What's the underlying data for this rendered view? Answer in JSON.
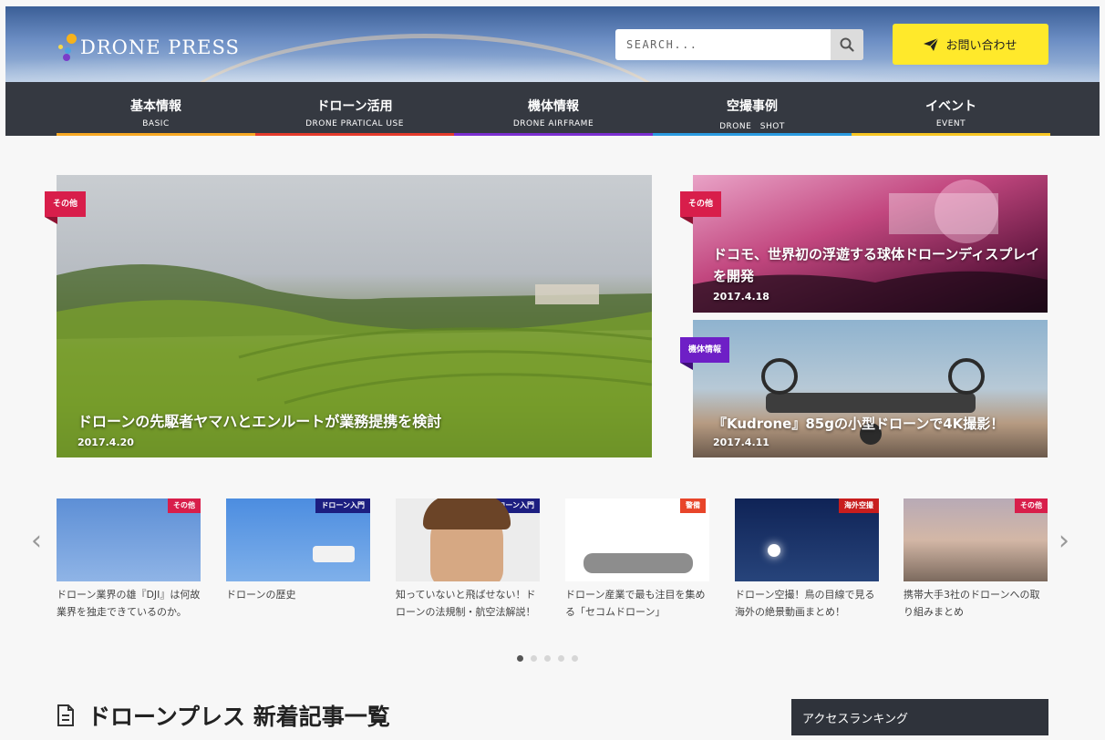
{
  "header": {
    "logo_text": "DRONE PRESS",
    "search_placeholder": "SEARCH...",
    "contact_label": "お問い合わせ"
  },
  "nav": [
    {
      "jp": "基本情報",
      "en": "BASIC",
      "color": "#f7a823"
    },
    {
      "jp": "ドローン活用",
      "en": "DRONE PRATICAL USE",
      "color": "#e53b2c"
    },
    {
      "jp": "機体情報",
      "en": "DRONE AIRFRAME",
      "color": "#7b2fd0"
    },
    {
      "jp": "空撮事例",
      "en": "DRONE　SHOT",
      "color": "#2b9be0"
    },
    {
      "jp": "イベント",
      "en": "EVENT",
      "color": "#f7c623"
    }
  ],
  "featured": {
    "main": {
      "tag": "その他",
      "title": "ドローンの先駆者ヤマハとエンルートが業務提携を検討",
      "date": "2017.4.20"
    },
    "side": [
      {
        "tag": "その他",
        "title": "ドコモ、世界初の浮遊する球体ドローンディスプレイを開発",
        "date": "2017.4.18"
      },
      {
        "tag": "機体情報",
        "title": "『Kudrone』85gの小型ドローンで4K撮影！",
        "date": "2017.4.11"
      }
    ]
  },
  "carousel": [
    {
      "tag": "その他",
      "tag_color": "#d81e4b",
      "title": "ドローン業界の雄『DJI』は何故業界を独走できているのか。"
    },
    {
      "tag": "ドローン入門",
      "tag_color": "#1c1e80",
      "title": "ドローンの歴史"
    },
    {
      "tag": "ドローン入門",
      "tag_color": "#1c1e80",
      "title": "知っていないと飛ばせない！ドローンの法規制・航空法解説！"
    },
    {
      "tag": "警備",
      "tag_color": "#e8452a",
      "title": "ドローン産業で最も注目を集める「セコムドローン」"
    },
    {
      "tag": "海外空撮",
      "tag_color": "#c81d1d",
      "title": "ドローン空撮！鳥の目線で見る海外の絶景動画まとめ！"
    },
    {
      "tag": "その他",
      "tag_color": "#d81e4b",
      "title": "携帯大手3社のドローンへの取り組みまとめ"
    }
  ],
  "section_title": "ドローンプレス 新着記事一覧",
  "ranking_title": "アクセスランキング",
  "icons": {
    "search": "magnifier-icon",
    "contact": "paper-plane-icon",
    "prev": "chevron-left-icon",
    "next": "chevron-right-icon",
    "article": "document-icon"
  }
}
